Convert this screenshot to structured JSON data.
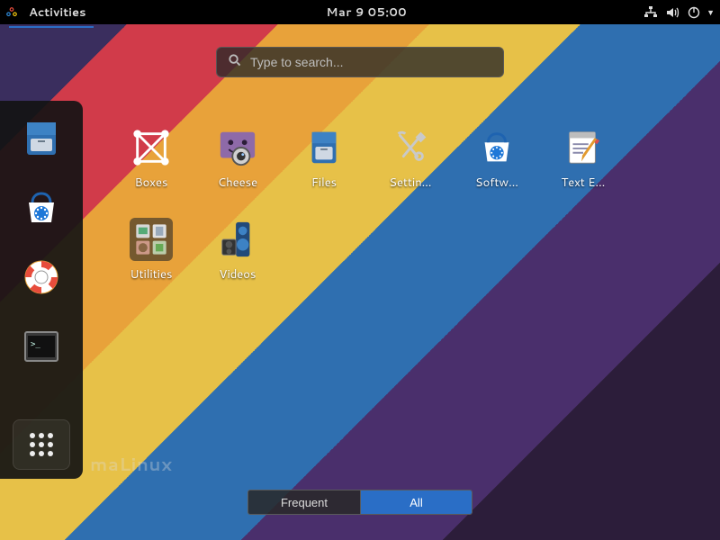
{
  "topbar": {
    "activities": "Activities",
    "clock": "Mar 9  05:00"
  },
  "search": {
    "placeholder": "Type to search..."
  },
  "apps": {
    "row1": [
      {
        "label": "Boxes"
      },
      {
        "label": "Cheese"
      },
      {
        "label": "Files"
      },
      {
        "label": "Settin…"
      },
      {
        "label": "Softw…"
      },
      {
        "label": "Text E…"
      }
    ],
    "row2": [
      {
        "label": "Utilities"
      },
      {
        "label": "Videos"
      }
    ]
  },
  "brand": "maLinux",
  "toggle": {
    "frequent": "Frequent",
    "all": "All",
    "active": "all"
  }
}
